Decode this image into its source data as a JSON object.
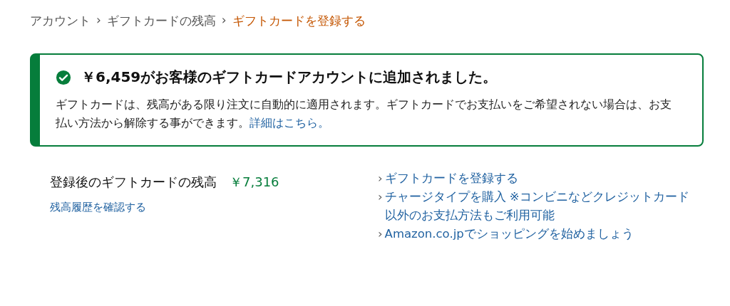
{
  "breadcrumb": [
    {
      "label": "アカウント",
      "current": false
    },
    {
      "separator": "›"
    },
    {
      "label": "ギフトカードの残高",
      "current": false
    },
    {
      "separator": "›"
    },
    {
      "label": "ギフトカードを登録する",
      "current": true
    }
  ],
  "alert": {
    "title": "￥6,459がお客様のギフトカードアカウントに追加されました。",
    "message": "ギフトカードは、残高がある限り注文に自動的に適用されます。ギフトカードでお支払いをご希望されない場合は、お支払い方法から解除する事ができます。",
    "link": "詳細はこちら。"
  },
  "balance": {
    "label": "登録後のギフトカードの残高",
    "amount": "￥7,316",
    "history_link": "残高履歴を確認する"
  },
  "links": [
    {
      "marker": "›",
      "label": "ギフトカードを登録する"
    },
    {
      "marker": "›",
      "label": "チャージタイプを購入 ※コンビニなどクレジットカード以外のお支払方法もご利用可能"
    },
    {
      "marker": "›",
      "label": "Amazon.co.jpでショッピングを始めましょう"
    }
  ]
}
